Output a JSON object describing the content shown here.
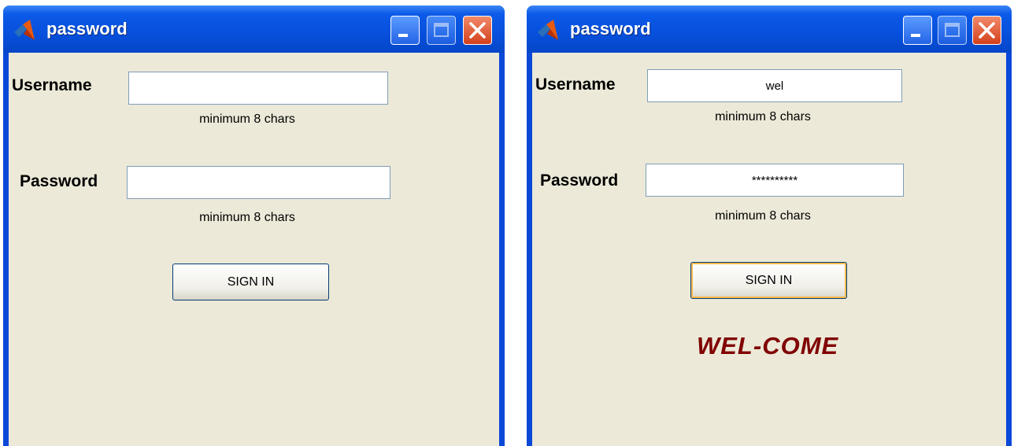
{
  "left_window": {
    "title": "password",
    "username_label": "Username",
    "username_value": "",
    "username_hint": "minimum 8 chars",
    "password_label": "Password",
    "password_value": "",
    "password_hint": "minimum 8 chars",
    "signin_label": "SIGN IN"
  },
  "right_window": {
    "title": "password",
    "username_label": "Username",
    "username_value": "wel",
    "username_hint": "minimum 8 chars",
    "password_label": "Password",
    "password_value": "**********",
    "password_hint": "minimum 8 chars",
    "signin_label": "SIGN IN",
    "message": "WEL-COME"
  },
  "colors": {
    "titlebar": "#0650dc",
    "client_bg": "#ece9d8",
    "close_button": "#d4401c",
    "welcome_text": "#800000"
  },
  "icons": [
    "matlab-icon",
    "minimize-icon",
    "maximize-icon",
    "close-icon"
  ]
}
